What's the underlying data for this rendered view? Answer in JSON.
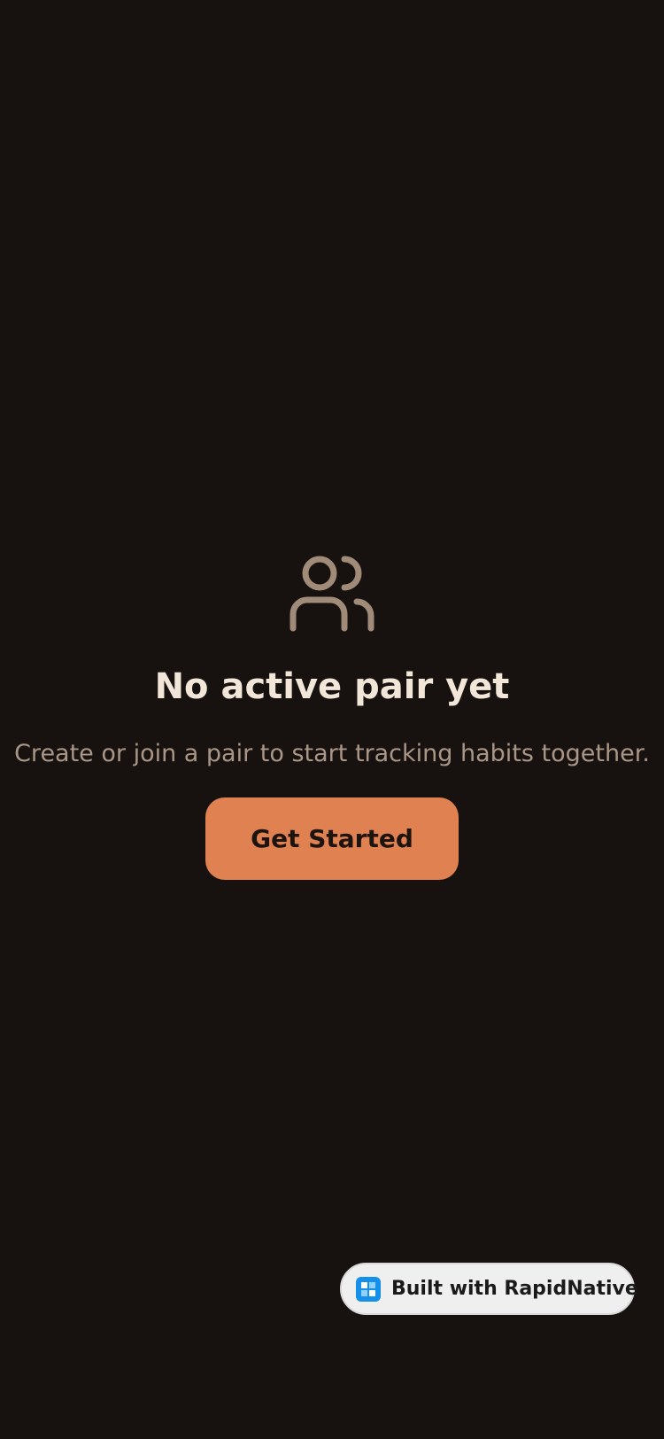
{
  "empty_state": {
    "icon": "users-icon",
    "title": "No active pair yet",
    "subtitle": "Create or join a pair to start tracking habits together.",
    "cta_label": "Get Started"
  },
  "badge": {
    "icon": "rapidnative-logo-icon",
    "label": "Built with RapidNative"
  },
  "colors": {
    "background": "#17120f",
    "title": "#f2e6d9",
    "subtitle": "#a99686",
    "icon": "#a08a78",
    "accent": "#e08152",
    "badge_bg": "#efefef",
    "badge_logo": "#1590e8"
  }
}
